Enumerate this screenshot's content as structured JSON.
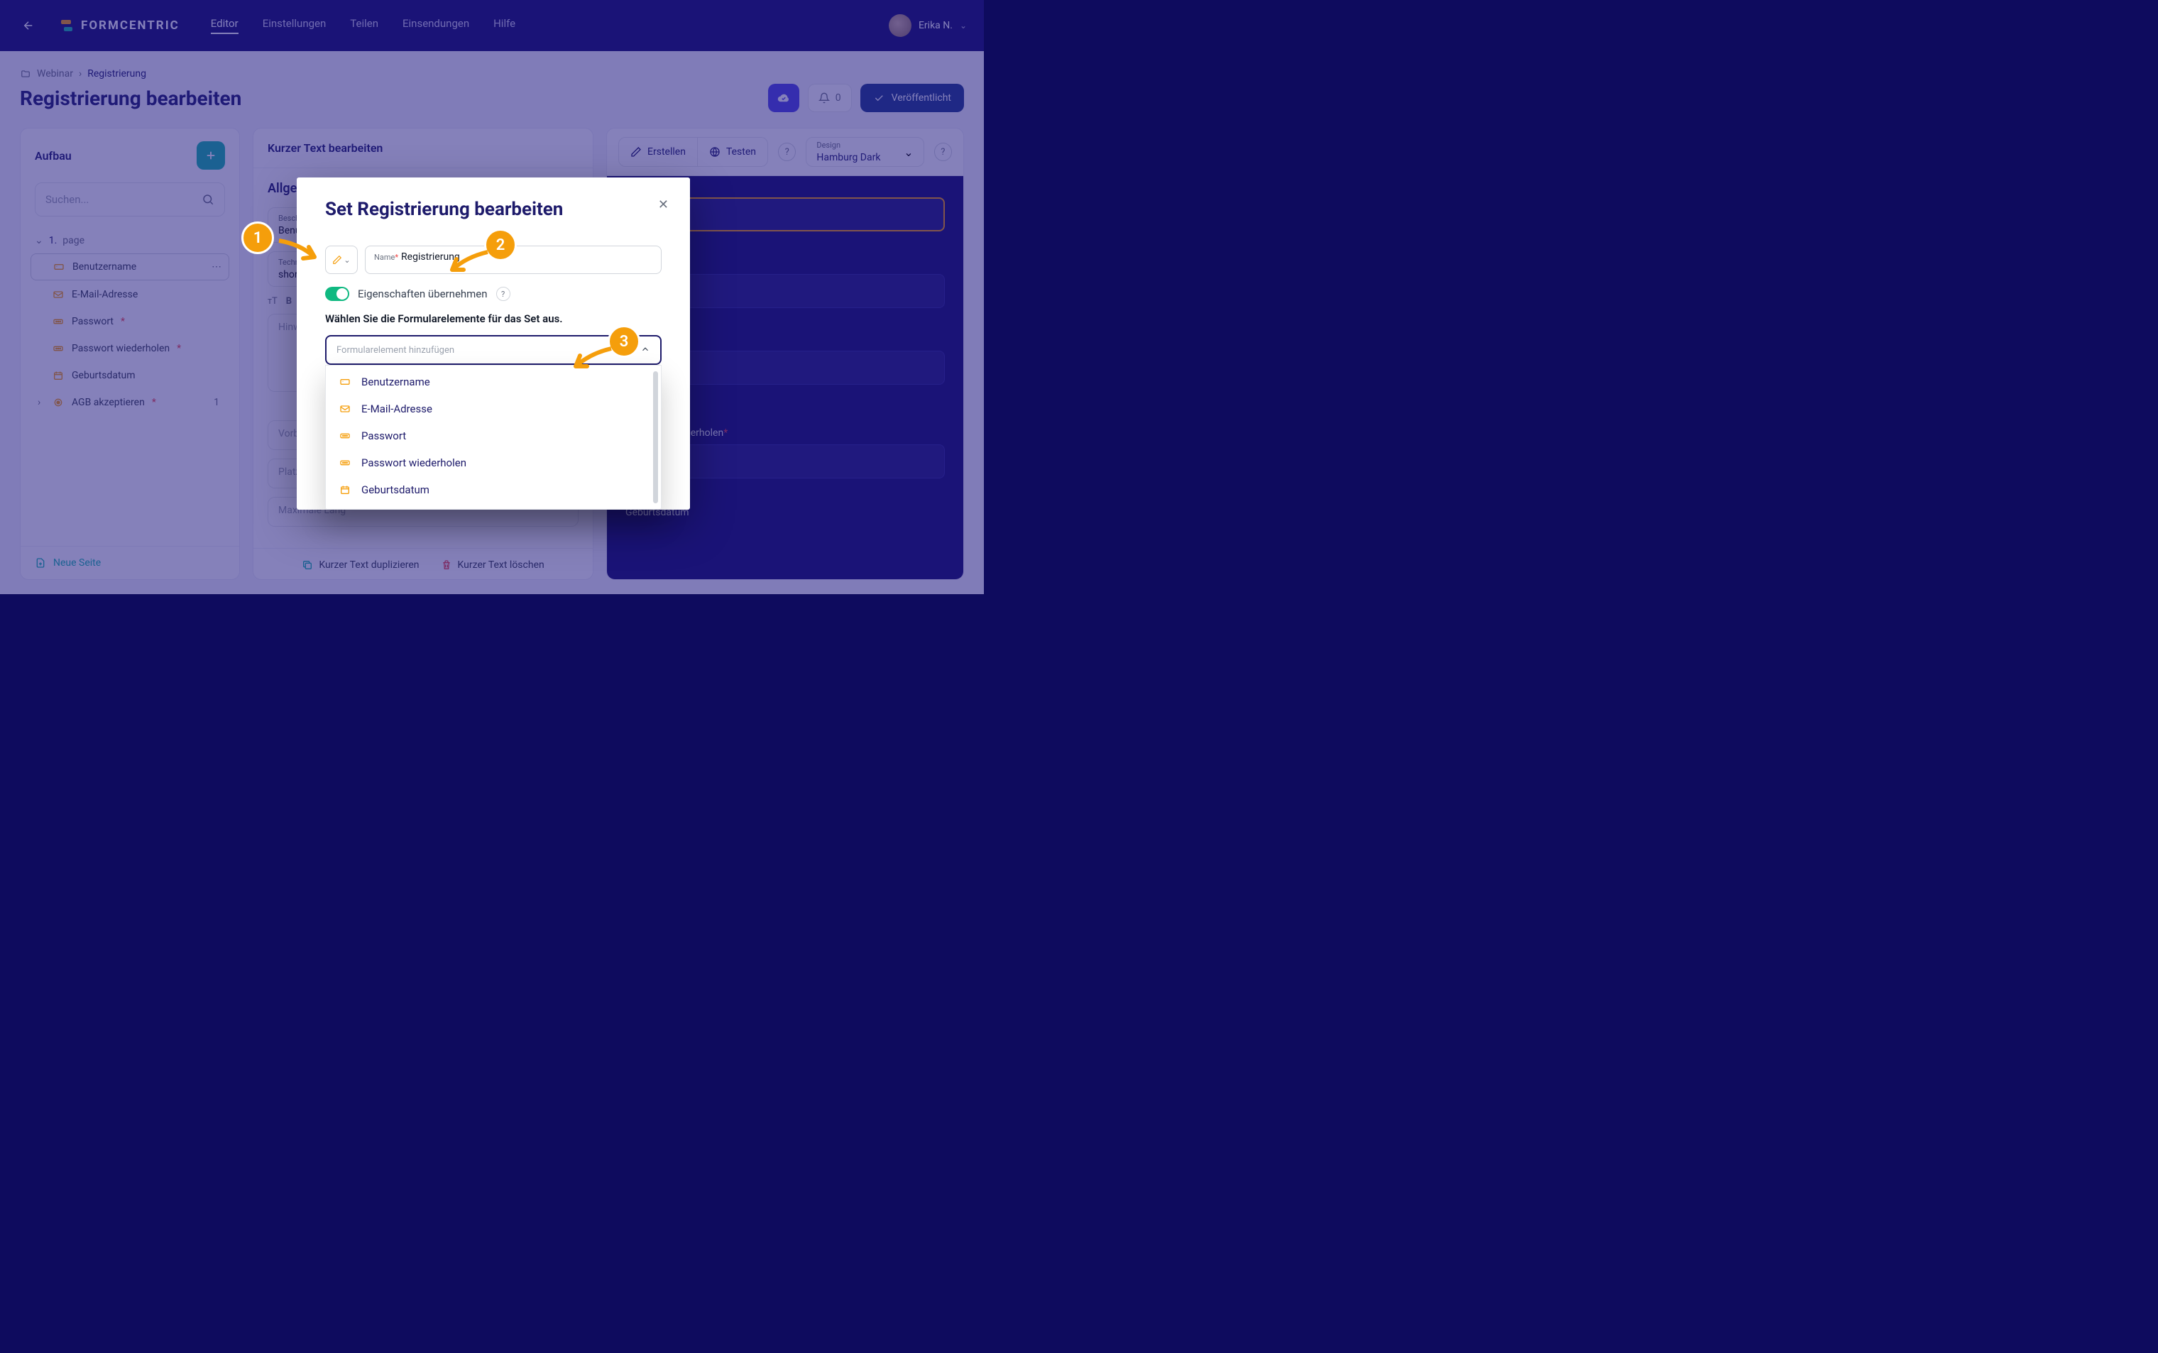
{
  "brand": "FORMCENTRIC",
  "nav": {
    "editor": "Editor",
    "settings": "Einstellungen",
    "share": "Teilen",
    "submissions": "Einsendungen",
    "help": "Hilfe"
  },
  "user": {
    "name": "Erika N."
  },
  "breadcrumb": {
    "folder": "Webinar",
    "item": "Registrierung"
  },
  "page_title": "Registrierung bearbeiten",
  "header_actions": {
    "notify_count": "0",
    "publish_label": "Veröffentlicht"
  },
  "col1": {
    "title": "Aufbau",
    "search_placeholder": "Suchen...",
    "page_prefix": "1.",
    "page_label": "page",
    "items": {
      "username": "Benutzername",
      "email": "E-Mail-Adresse",
      "password": "Passwort",
      "password_repeat": "Passwort wiederholen",
      "birthdate": "Geburtsdatum",
      "agb": "AGB akzeptieren",
      "agb_count": "1"
    },
    "new_page": "Neue Seite"
  },
  "col2": {
    "title": "Kurzer Text bearbeiten",
    "section": "Allgeme",
    "label_field_label": "Beschriftung",
    "label_field_value": "Benutz",
    "tech_field_label": "Technisch",
    "tech_field_value": "shortTe",
    "hint_label": "Hinweis",
    "prefill_label": "Vorbele",
    "placeholder_label": "Platzhalter",
    "max_label": "Maximale Läng",
    "dup_label": "Kurzer Text duplizieren",
    "del_label": "Kurzer Text löschen"
  },
  "col3": {
    "create": "Erstellen",
    "test": "Testen",
    "design_label": "Design",
    "design_value": "Hamburg Dark",
    "pv_pwrepeat": "wiederholen",
    "pv_birth": "Geburtsdatum"
  },
  "modal": {
    "title": "Set Registrierung bearbeiten",
    "name_label": "Name",
    "name_value": "Registrierung",
    "toggle_label": "Eigenschaften übernehmen",
    "instruction": "Wählen Sie die Formularelemente für das Set aus.",
    "combo_placeholder": "Formularelement hinzufügen",
    "options": {
      "o1": "Benutzername",
      "o2": "E-Mail-Adresse",
      "o3": "Passwort",
      "o4": "Passwort wiederholen",
      "o5": "Geburtsdatum"
    }
  },
  "callouts": {
    "c1": "1",
    "c2": "2",
    "c3": "3"
  }
}
